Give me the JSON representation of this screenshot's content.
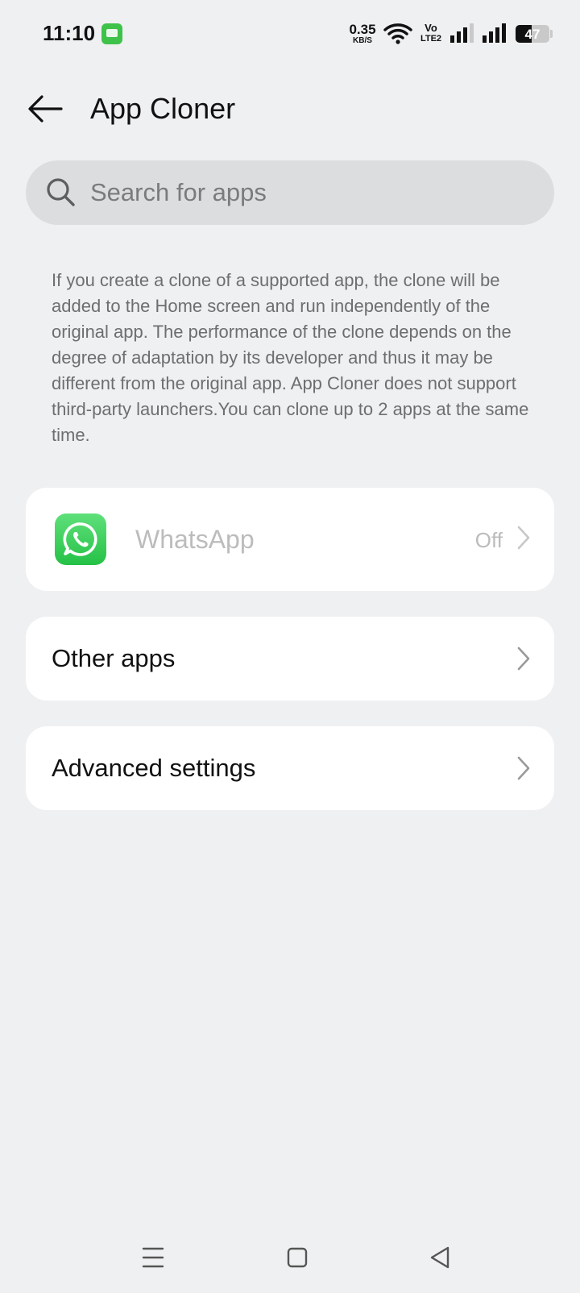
{
  "status_bar": {
    "time": "11:10",
    "net_speed_value": "0.35",
    "net_speed_unit": "KB/S",
    "volte_top": "Vo",
    "volte_bottom": "LTE2",
    "battery_level": "47",
    "battery_fraction": 0.47
  },
  "header": {
    "title": "App Cloner"
  },
  "search": {
    "placeholder": "Search for apps",
    "value": ""
  },
  "description": "If you create a clone of a supported app, the clone will be added to the Home screen and run independently of the original app. The performance of the clone depends on the degree of adaptation by its developer and thus it may be different from the original app. App Cloner does not support third-party launchers.You can clone up to 2 apps at the same time.",
  "apps": [
    {
      "name": "WhatsApp",
      "status": "Off",
      "icon": "whatsapp-icon"
    }
  ],
  "rows": {
    "other_apps": "Other apps",
    "advanced_settings": "Advanced settings"
  },
  "colors": {
    "background": "#eff0f2",
    "card": "#ffffff",
    "whatsapp_green": "#25c146"
  }
}
